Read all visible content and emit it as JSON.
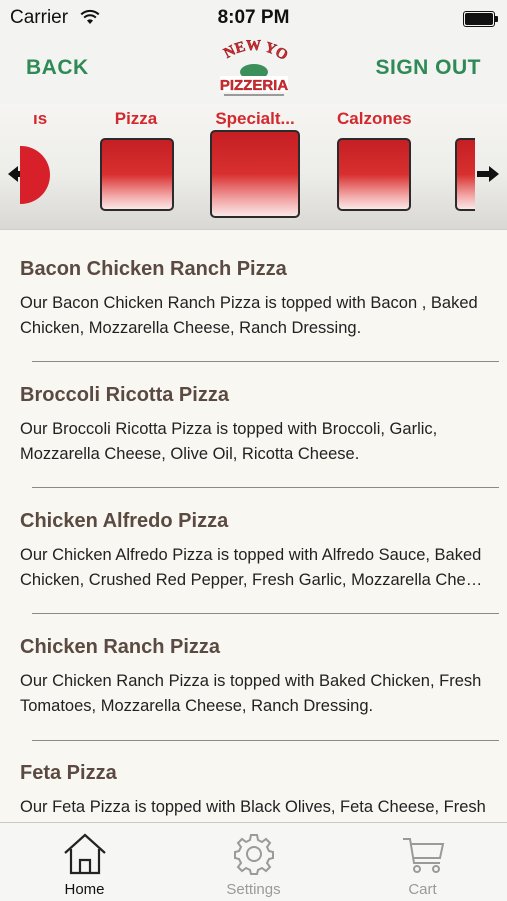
{
  "status": {
    "carrier": "Carrier",
    "time": "8:07 PM"
  },
  "nav": {
    "back": "BACK",
    "sign_out": "SIGN OUT",
    "logo_text": "NEW YORK Pizzeria"
  },
  "categories": [
    {
      "label": "ıs"
    },
    {
      "label": "Pizza"
    },
    {
      "label": "Specialt..."
    },
    {
      "label": "Calzones"
    }
  ],
  "items": [
    {
      "title": "Bacon Chicken Ranch Pizza",
      "desc1": "Our Bacon Chicken Ranch Pizza is topped with Bacon , Baked",
      "desc2": "Chicken, Mozzarella Cheese, Ranch Dressing."
    },
    {
      "title": "Broccoli Ricotta Pizza",
      "desc1": "Our Broccoli Ricotta Pizza is topped with Broccoli, Garlic,",
      "desc2": "Mozzarella Cheese, Olive Oil, Ricotta Cheese."
    },
    {
      "title": "Chicken Alfredo Pizza",
      "desc1": "Our Chicken Alfredo Pizza is topped with Alfredo Sauce, Baked",
      "desc2": "Chicken, Crushed Red Pepper, Fresh Garlic, Mozzarella Chees…"
    },
    {
      "title": "Chicken Ranch Pizza",
      "desc1": "Our Chicken Ranch Pizza is topped with Baked Chicken, Fresh",
      "desc2": "Tomatoes, Mozzarella Cheese, Ranch Dressing."
    },
    {
      "title": "Feta Pizza",
      "desc1": "Our Feta Pizza is topped with Black Olives, Feta Cheese, Fresh",
      "desc2": ""
    }
  ],
  "tabs": {
    "home": "Home",
    "settings": "Settings",
    "cart": "Cart"
  },
  "colors": {
    "accent_green": "#2f8a56",
    "category_red": "#d2282e",
    "tab_active": "#111111",
    "tab_inactive": "#9a9a9a"
  }
}
